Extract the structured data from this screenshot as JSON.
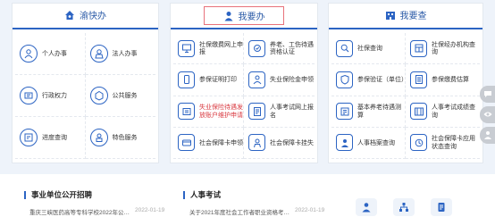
{
  "panels": [
    {
      "title": "渝快办",
      "icon": "home-icon",
      "items": [
        {
          "label": "个人办事",
          "icon": "person-icon"
        },
        {
          "label": "法人办事",
          "icon": "legal-person-icon"
        },
        {
          "label": "行政权力",
          "icon": "admin-power-icon"
        },
        {
          "label": "公共服务",
          "icon": "public-service-icon"
        },
        {
          "label": "进度查询",
          "icon": "progress-query-icon"
        },
        {
          "label": "特色服务",
          "icon": "special-service-icon"
        }
      ]
    },
    {
      "title": "我要办",
      "icon": "user-icon",
      "items": [
        {
          "label": "社保缴费网上申报",
          "icon": "monitor-icon"
        },
        {
          "label": "养老、工伤待遇资格认证",
          "icon": "certify-icon"
        },
        {
          "label": "参保证明打印",
          "icon": "phone-icon"
        },
        {
          "label": "失业保险金申领",
          "icon": "unemployment-icon"
        },
        {
          "label": "失业保险待遇发放账户维护申请",
          "icon": "account-icon",
          "highlight": true
        },
        {
          "label": "人事考试网上报名",
          "icon": "exam-icon"
        },
        {
          "label": "社会保障卡申领",
          "icon": "card-icon"
        },
        {
          "label": "社会保障卡挂失",
          "icon": "card-loss-icon"
        }
      ]
    },
    {
      "title": "我要查",
      "icon": "building-icon",
      "items": [
        {
          "label": "社保查询",
          "icon": "search-icon"
        },
        {
          "label": "社保经办机构查询",
          "icon": "office-icon"
        },
        {
          "label": "参保验证（单位）",
          "icon": "verify-icon"
        },
        {
          "label": "参保缴费估算",
          "icon": "estimate-icon"
        },
        {
          "label": "基本养老待遇测算",
          "icon": "pension-icon"
        },
        {
          "label": "人事考试成绩查询",
          "icon": "score-icon"
        },
        {
          "label": "人事档案查询",
          "icon": "archive-icon"
        },
        {
          "label": "社会保障卡应用状态查询",
          "icon": "card-status-icon"
        }
      ]
    }
  ],
  "sections": [
    {
      "title": "事业单位公开招聘",
      "news": {
        "text": "重庆三峡医药高等专科学校2022年公…",
        "date": "2022-01-19"
      }
    },
    {
      "title": "人事考试",
      "news": {
        "text": "关于2021年度社会工作者职业资格考…",
        "date": "2022-01-19"
      }
    }
  ],
  "colors": {
    "accent": "#2c64c3",
    "active_border": "#e8727b",
    "highlight_text": "#d9383f"
  }
}
